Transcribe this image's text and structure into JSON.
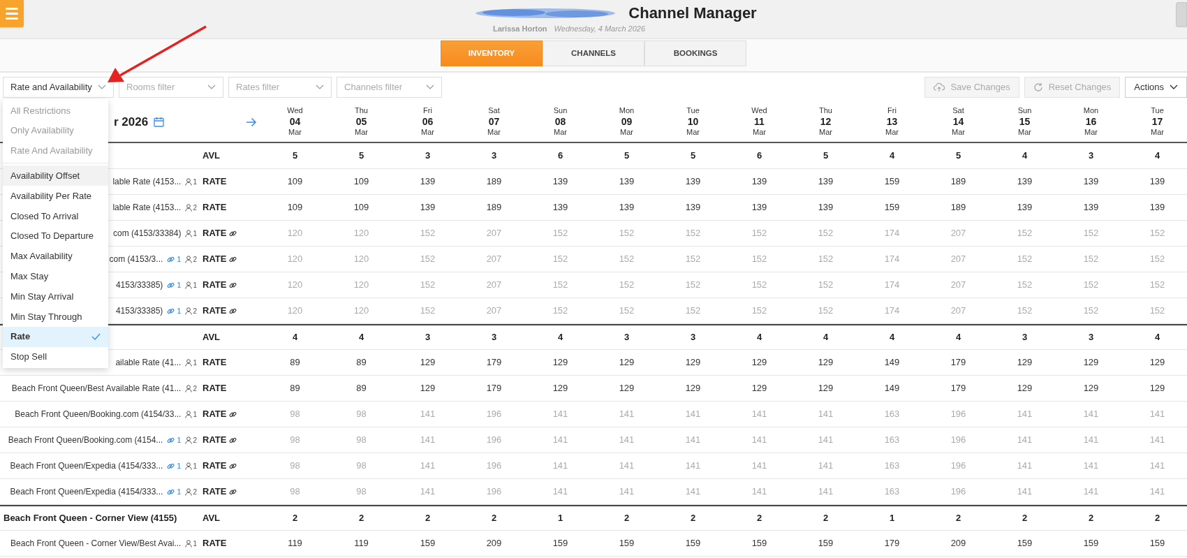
{
  "header": {
    "title": "Channel Manager",
    "user": "Larissa Horton",
    "date": "Wednesday, 4 March 2026"
  },
  "tabs": [
    {
      "label": "INVENTORY",
      "selected": true
    },
    {
      "label": "CHANNELS",
      "selected": false
    },
    {
      "label": "BOOKINGS",
      "selected": false
    }
  ],
  "filters": {
    "view_select": {
      "value": "Rate and Availability"
    },
    "rooms": {
      "placeholder": "Rooms filter"
    },
    "rates": {
      "placeholder": "Rates filter"
    },
    "channels": {
      "placeholder": "Channels filter"
    }
  },
  "actions": [
    {
      "kind": "upload",
      "label": "Save Changes",
      "disabled": true
    },
    {
      "kind": "reset",
      "label": "Reset Changes",
      "disabled": true
    },
    {
      "kind": "dropdown",
      "label": "Actions",
      "disabled": false
    }
  ],
  "calendar": {
    "month": "r 2026",
    "days": [
      {
        "weekday": "Wed",
        "day": "04",
        "month": "Mar"
      },
      {
        "weekday": "Thu",
        "day": "05",
        "month": "Mar"
      },
      {
        "weekday": "Fri",
        "day": "06",
        "month": "Mar"
      },
      {
        "weekday": "Sat",
        "day": "07",
        "month": "Mar"
      },
      {
        "weekday": "Sun",
        "day": "08",
        "month": "Mar"
      },
      {
        "weekday": "Mon",
        "day": "09",
        "month": "Mar"
      },
      {
        "weekday": "Tue",
        "day": "10",
        "month": "Mar"
      },
      {
        "weekday": "Wed",
        "day": "11",
        "month": "Mar"
      },
      {
        "weekday": "Thu",
        "day": "12",
        "month": "Mar"
      },
      {
        "weekday": "Fri",
        "day": "13",
        "month": "Mar"
      },
      {
        "weekday": "Sat",
        "day": "14",
        "month": "Mar"
      },
      {
        "weekday": "Sun",
        "day": "15",
        "month": "Mar"
      },
      {
        "weekday": "Mon",
        "day": "16",
        "month": "Mar"
      },
      {
        "weekday": "Tue",
        "day": "17",
        "month": "Mar"
      }
    ]
  },
  "rows": [
    {
      "kind": "avl",
      "type_label": "AVL",
      "values": [
        "5",
        "5",
        "3",
        "3",
        "6",
        "5",
        "5",
        "6",
        "5",
        "4",
        "5",
        "4",
        "3",
        "4"
      ]
    },
    {
      "kind": "rate",
      "label": "lable Rate (4153...",
      "occupancy": "1",
      "type_label": "RATE",
      "linked": false,
      "values": [
        "109",
        "109",
        "139",
        "189",
        "139",
        "139",
        "139",
        "139",
        "139",
        "159",
        "189",
        "139",
        "139",
        "139"
      ]
    },
    {
      "kind": "rate",
      "label": "lable Rate (4153...",
      "occupancy": "2",
      "type_label": "RATE",
      "linked": false,
      "values": [
        "109",
        "109",
        "139",
        "189",
        "139",
        "139",
        "139",
        "139",
        "139",
        "159",
        "189",
        "139",
        "139",
        "139"
      ]
    },
    {
      "kind": "rate",
      "label": "com (4153/33384)",
      "occupancy": "1",
      "type_label": "RATE",
      "linked": true,
      "values": [
        "120",
        "120",
        "152",
        "207",
        "152",
        "152",
        "152",
        "152",
        "152",
        "174",
        "207",
        "152",
        "152",
        "152"
      ]
    },
    {
      "kind": "rate",
      "label": "com (4153/3...",
      "link_count": "1",
      "occupancy": "2",
      "type_label": "RATE",
      "linked": true,
      "values": [
        "120",
        "120",
        "152",
        "207",
        "152",
        "152",
        "152",
        "152",
        "152",
        "174",
        "207",
        "152",
        "152",
        "152"
      ]
    },
    {
      "kind": "rate",
      "label": "4153/33385)",
      "link_count": "1",
      "occupancy": "1",
      "type_label": "RATE",
      "linked": true,
      "values": [
        "120",
        "120",
        "152",
        "207",
        "152",
        "152",
        "152",
        "152",
        "152",
        "174",
        "207",
        "152",
        "152",
        "152"
      ]
    },
    {
      "kind": "rate",
      "label": "4153/33385)",
      "link_count": "1",
      "occupancy": "2",
      "type_label": "RATE",
      "linked": true,
      "values": [
        "120",
        "120",
        "152",
        "207",
        "152",
        "152",
        "152",
        "152",
        "152",
        "174",
        "207",
        "152",
        "152",
        "152"
      ]
    },
    {
      "kind": "avl",
      "type_label": "AVL",
      "values": [
        "4",
        "4",
        "3",
        "3",
        "4",
        "3",
        "3",
        "4",
        "4",
        "4",
        "4",
        "3",
        "3",
        "4"
      ]
    },
    {
      "kind": "rate",
      "label": "ailable Rate (41...",
      "occupancy": "1",
      "type_label": "RATE",
      "linked": false,
      "values": [
        "89",
        "89",
        "129",
        "179",
        "129",
        "129",
        "129",
        "129",
        "129",
        "149",
        "179",
        "129",
        "129",
        "129"
      ]
    },
    {
      "kind": "rate",
      "label": "Beach Front Queen/Best Available Rate (41...",
      "occupancy": "2",
      "type_label": "RATE",
      "linked": false,
      "values": [
        "89",
        "89",
        "129",
        "179",
        "129",
        "129",
        "129",
        "129",
        "129",
        "149",
        "179",
        "129",
        "129",
        "129"
      ]
    },
    {
      "kind": "rate",
      "label": "Beach Front Queen/Booking.com (4154/33...",
      "occupancy": "1",
      "type_label": "RATE",
      "linked": true,
      "values": [
        "98",
        "98",
        "141",
        "196",
        "141",
        "141",
        "141",
        "141",
        "141",
        "163",
        "196",
        "141",
        "141",
        "141"
      ]
    },
    {
      "kind": "rate",
      "label": "Beach Front Queen/Booking.com (4154...",
      "link_count": "1",
      "occupancy": "2",
      "type_label": "RATE",
      "linked": true,
      "values": [
        "98",
        "98",
        "141",
        "196",
        "141",
        "141",
        "141",
        "141",
        "141",
        "163",
        "196",
        "141",
        "141",
        "141"
      ]
    },
    {
      "kind": "rate",
      "label": "Beach Front Queen/Expedia (4154/333...",
      "link_count": "1",
      "occupancy": "1",
      "type_label": "RATE",
      "linked": true,
      "values": [
        "98",
        "98",
        "141",
        "196",
        "141",
        "141",
        "141",
        "141",
        "141",
        "163",
        "196",
        "141",
        "141",
        "141"
      ]
    },
    {
      "kind": "rate",
      "label": "Beach Front Queen/Expedia (4154/333...",
      "link_count": "1",
      "occupancy": "2",
      "type_label": "RATE",
      "linked": true,
      "values": [
        "98",
        "98",
        "141",
        "196",
        "141",
        "141",
        "141",
        "141",
        "141",
        "163",
        "196",
        "141",
        "141",
        "141"
      ]
    },
    {
      "kind": "avl",
      "label": "Beach Front Queen - Corner View (4155)",
      "type_label": "AVL",
      "values": [
        "2",
        "2",
        "2",
        "2",
        "1",
        "2",
        "2",
        "2",
        "2",
        "1",
        "2",
        "2",
        "2",
        "2"
      ]
    },
    {
      "kind": "rate",
      "label": "Beach Front Queen - Corner View/Best Avai...",
      "occupancy": "1",
      "type_label": "RATE",
      "linked": false,
      "values": [
        "119",
        "119",
        "159",
        "209",
        "159",
        "159",
        "159",
        "159",
        "159",
        "179",
        "209",
        "159",
        "159",
        "159"
      ]
    }
  ],
  "dropdown": {
    "groups": [
      {
        "items": [
          {
            "label": "All Restrictions",
            "disabled": true,
            "highlighted": false,
            "selected": false
          },
          {
            "label": "Only Availability",
            "disabled": true,
            "highlighted": false,
            "selected": false
          },
          {
            "label": "Rate And Availability",
            "disabled": true,
            "highlighted": false,
            "selected": false
          }
        ]
      },
      {
        "items": [
          {
            "label": "Availability Offset",
            "disabled": false,
            "highlighted": true,
            "selected": false
          },
          {
            "label": "Availability Per Rate",
            "disabled": false,
            "highlighted": false,
            "selected": false
          },
          {
            "label": "Closed To Arrival",
            "disabled": false,
            "highlighted": false,
            "selected": false
          },
          {
            "label": "Closed To Departure",
            "disabled": false,
            "highlighted": false,
            "selected": false
          },
          {
            "label": "Max Availability",
            "disabled": false,
            "highlighted": false,
            "selected": false
          },
          {
            "label": "Max Stay",
            "disabled": false,
            "highlighted": false,
            "selected": false
          },
          {
            "label": "Min Stay Arrival",
            "disabled": false,
            "highlighted": false,
            "selected": false
          },
          {
            "label": "Min Stay Through",
            "disabled": false,
            "highlighted": false,
            "selected": false
          },
          {
            "label": "Rate",
            "disabled": false,
            "highlighted": false,
            "selected": true
          },
          {
            "label": "Stop Sell",
            "disabled": false,
            "highlighted": false,
            "selected": false
          }
        ]
      }
    ]
  }
}
